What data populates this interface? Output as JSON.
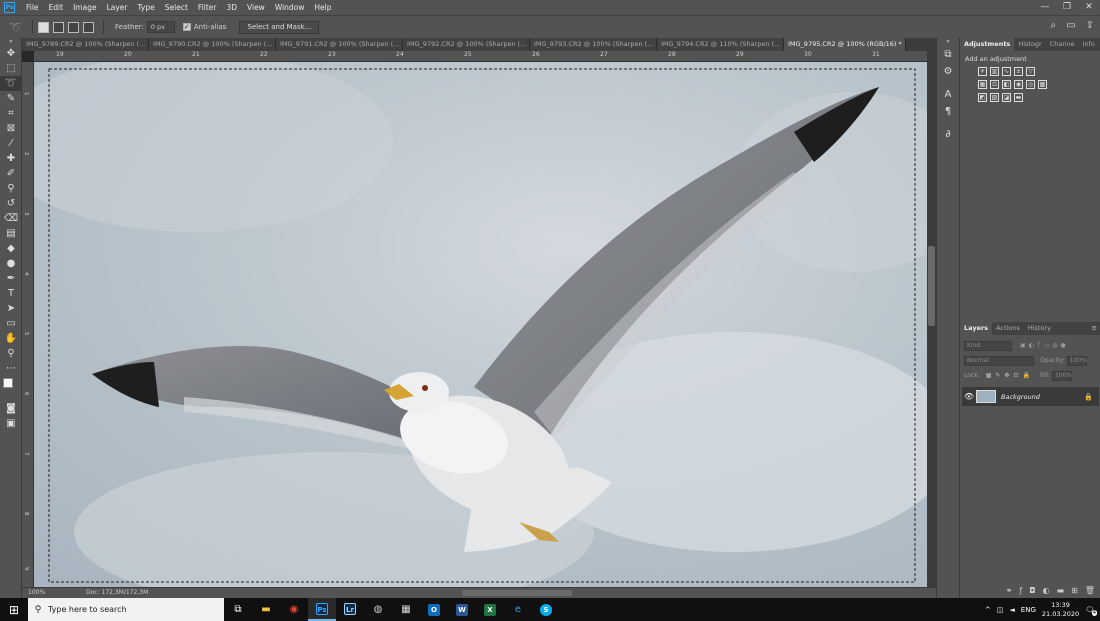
{
  "menu": {
    "items": [
      "File",
      "Edit",
      "Image",
      "Layer",
      "Type",
      "Select",
      "Filter",
      "3D",
      "View",
      "Window",
      "Help"
    ],
    "app_logo": "Ps",
    "window_controls": [
      "—",
      "❐",
      "✕"
    ]
  },
  "options": {
    "feather_label": "Feather:",
    "feather_value": "0 px",
    "antialias_label": "Anti-alias",
    "antialias_checked": true,
    "select_mask_label": "Select and Mask..."
  },
  "tabs": [
    {
      "label": "IMG_9789.CR2 @ 100% (Sharpen (...",
      "active": false
    },
    {
      "label": "IMG_9790.CR2 @ 100% (Sharpen (...",
      "active": false
    },
    {
      "label": "IMG_9791.CR2 @ 100% (Sharpen (...",
      "active": false
    },
    {
      "label": "IMG_9792.CR2 @ 100% (Sharpen (...",
      "active": false
    },
    {
      "label": "IMG_9793.CR2 @ 100% (Sharpen (...",
      "active": false
    },
    {
      "label": "IMG_9794.CR2 @ 110% (Sharpen (...",
      "active": false
    },
    {
      "label": "IMG_9795.CR2 @ 100% (RGB/16) *",
      "active": true
    }
  ],
  "ruler_top_labels": [
    "19",
    "20",
    "21",
    "22",
    "23",
    "24",
    "25",
    "26",
    "27",
    "28",
    "29",
    "30",
    "31"
  ],
  "ruler_left_labels": [
    "1",
    "2",
    "3",
    "4",
    "5",
    "6",
    "7",
    "8",
    "9"
  ],
  "status": {
    "zoom": "100%",
    "doc": "Doc: 172,3M/172,3M"
  },
  "adjustments": {
    "tabs": [
      "Adjustments",
      "Histogr",
      "Channe",
      "Info"
    ],
    "add_label": "Add an adjustment"
  },
  "layers": {
    "tabs": [
      "Layers",
      "Actions",
      "History"
    ],
    "kind_label": "Kind",
    "blend_mode": "Normal",
    "opacity_label": "Opacity:",
    "opacity_value": "100%",
    "lock_label": "Lock:",
    "fill_label": "Fill:",
    "fill_value": "100%",
    "items": [
      {
        "name": "Background",
        "visible": true,
        "locked": true
      }
    ]
  },
  "taskbar": {
    "search_placeholder": "Type here to search",
    "lang": "ENG",
    "time": "13:39",
    "date": "21.03.2020",
    "notifications": "4"
  }
}
